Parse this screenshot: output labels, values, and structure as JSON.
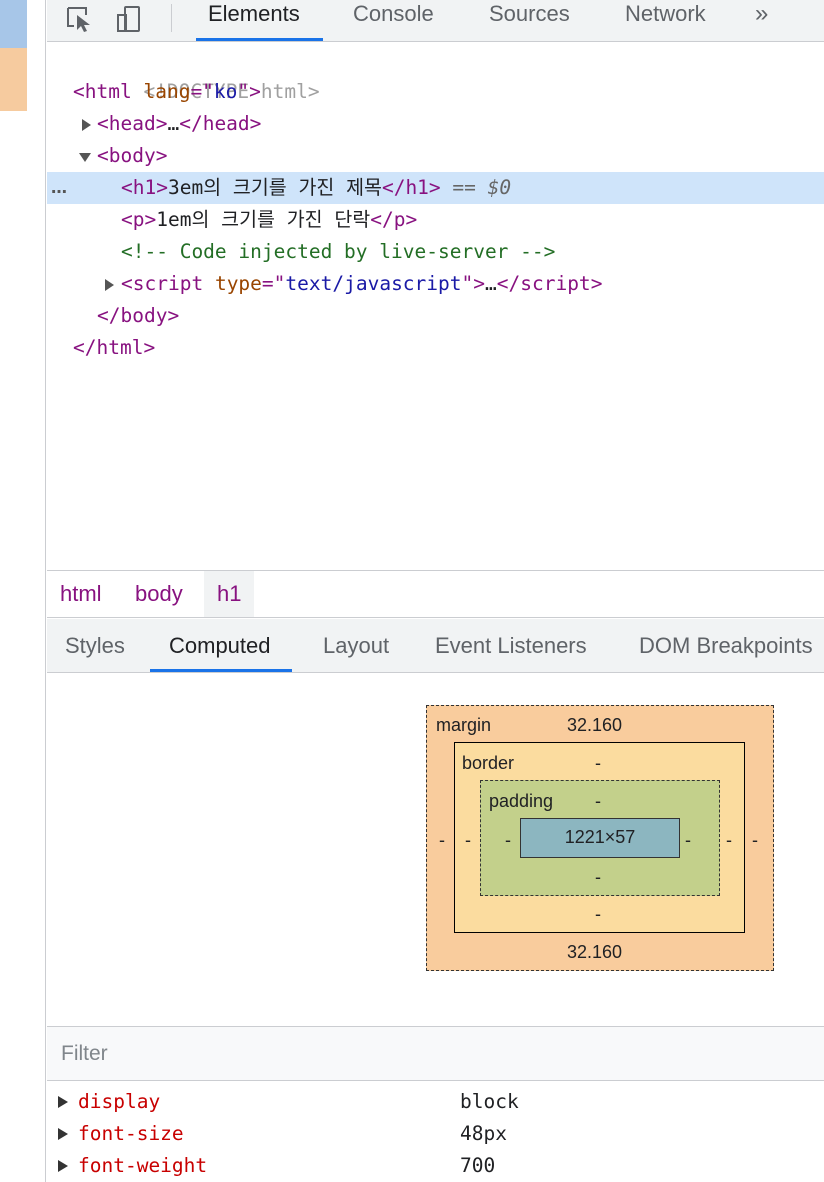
{
  "toolbar": {
    "inspect_icon": "inspect-element-icon",
    "device_icon": "device-toolbar-icon",
    "tabs": [
      {
        "label": "Elements",
        "active": true
      },
      {
        "label": "Console",
        "active": false
      },
      {
        "label": "Sources",
        "active": false
      },
      {
        "label": "Network",
        "active": false
      }
    ],
    "more": "»"
  },
  "dom": {
    "doctype": "<!DOCTYPE html>",
    "html_open": {
      "tag": "html",
      "attr": "lang",
      "value": "ko"
    },
    "head": {
      "open": "head",
      "ellipsis": "…",
      "close": "head"
    },
    "body_open": "body",
    "h1": {
      "tag": "h1",
      "text": "3em의 크기를 가진 제목",
      "selected_marker": " == $0",
      "dots": "…"
    },
    "p": {
      "tag": "p",
      "text": "1em의 크기를 가진 단락"
    },
    "comment": "<!-- Code injected by live-server -->",
    "script": {
      "tag": "script",
      "attr": "type",
      "value": "text/javascript",
      "ellipsis": "…"
    },
    "body_close": "body",
    "html_close": "html"
  },
  "breadcrumb": [
    {
      "label": "html",
      "active": false
    },
    {
      "label": "body",
      "active": false
    },
    {
      "label": "h1",
      "active": true
    }
  ],
  "subtabs": [
    {
      "label": "Styles",
      "active": false
    },
    {
      "label": "Computed",
      "active": true
    },
    {
      "label": "Layout",
      "active": false
    },
    {
      "label": "Event Listeners",
      "active": false
    },
    {
      "label": "DOM Breakpoints",
      "active": false
    }
  ],
  "box_model": {
    "margin_label": "margin",
    "margin_top": "32.160",
    "margin_bottom": "32.160",
    "margin_left": "-",
    "margin_right": "-",
    "border_label": "border",
    "border_top": "-",
    "border_bottom": "-",
    "border_left": "-",
    "border_right": "-",
    "padding_label": "padding",
    "padding_top": "-",
    "padding_bottom": "-",
    "padding_left": "-",
    "padding_right": "-",
    "content": "1221×57"
  },
  "filter": {
    "placeholder": "Filter"
  },
  "computed": [
    {
      "name": "display",
      "value": "block"
    },
    {
      "name": "font-size",
      "value": "48px"
    },
    {
      "name": "font-weight",
      "value": "700"
    }
  ],
  "colors": {
    "accent": "#1a73e8",
    "selected_row": "#cfe4fa",
    "tag": "#881280",
    "attr_name": "#994500",
    "attr_value": "#1a1aa6",
    "comment": "#236e25",
    "prop_name": "#c80000",
    "margin": "#f9cc9d",
    "border": "#fbdc9f",
    "padding": "#c3d08b",
    "content": "#8cb6c0"
  }
}
